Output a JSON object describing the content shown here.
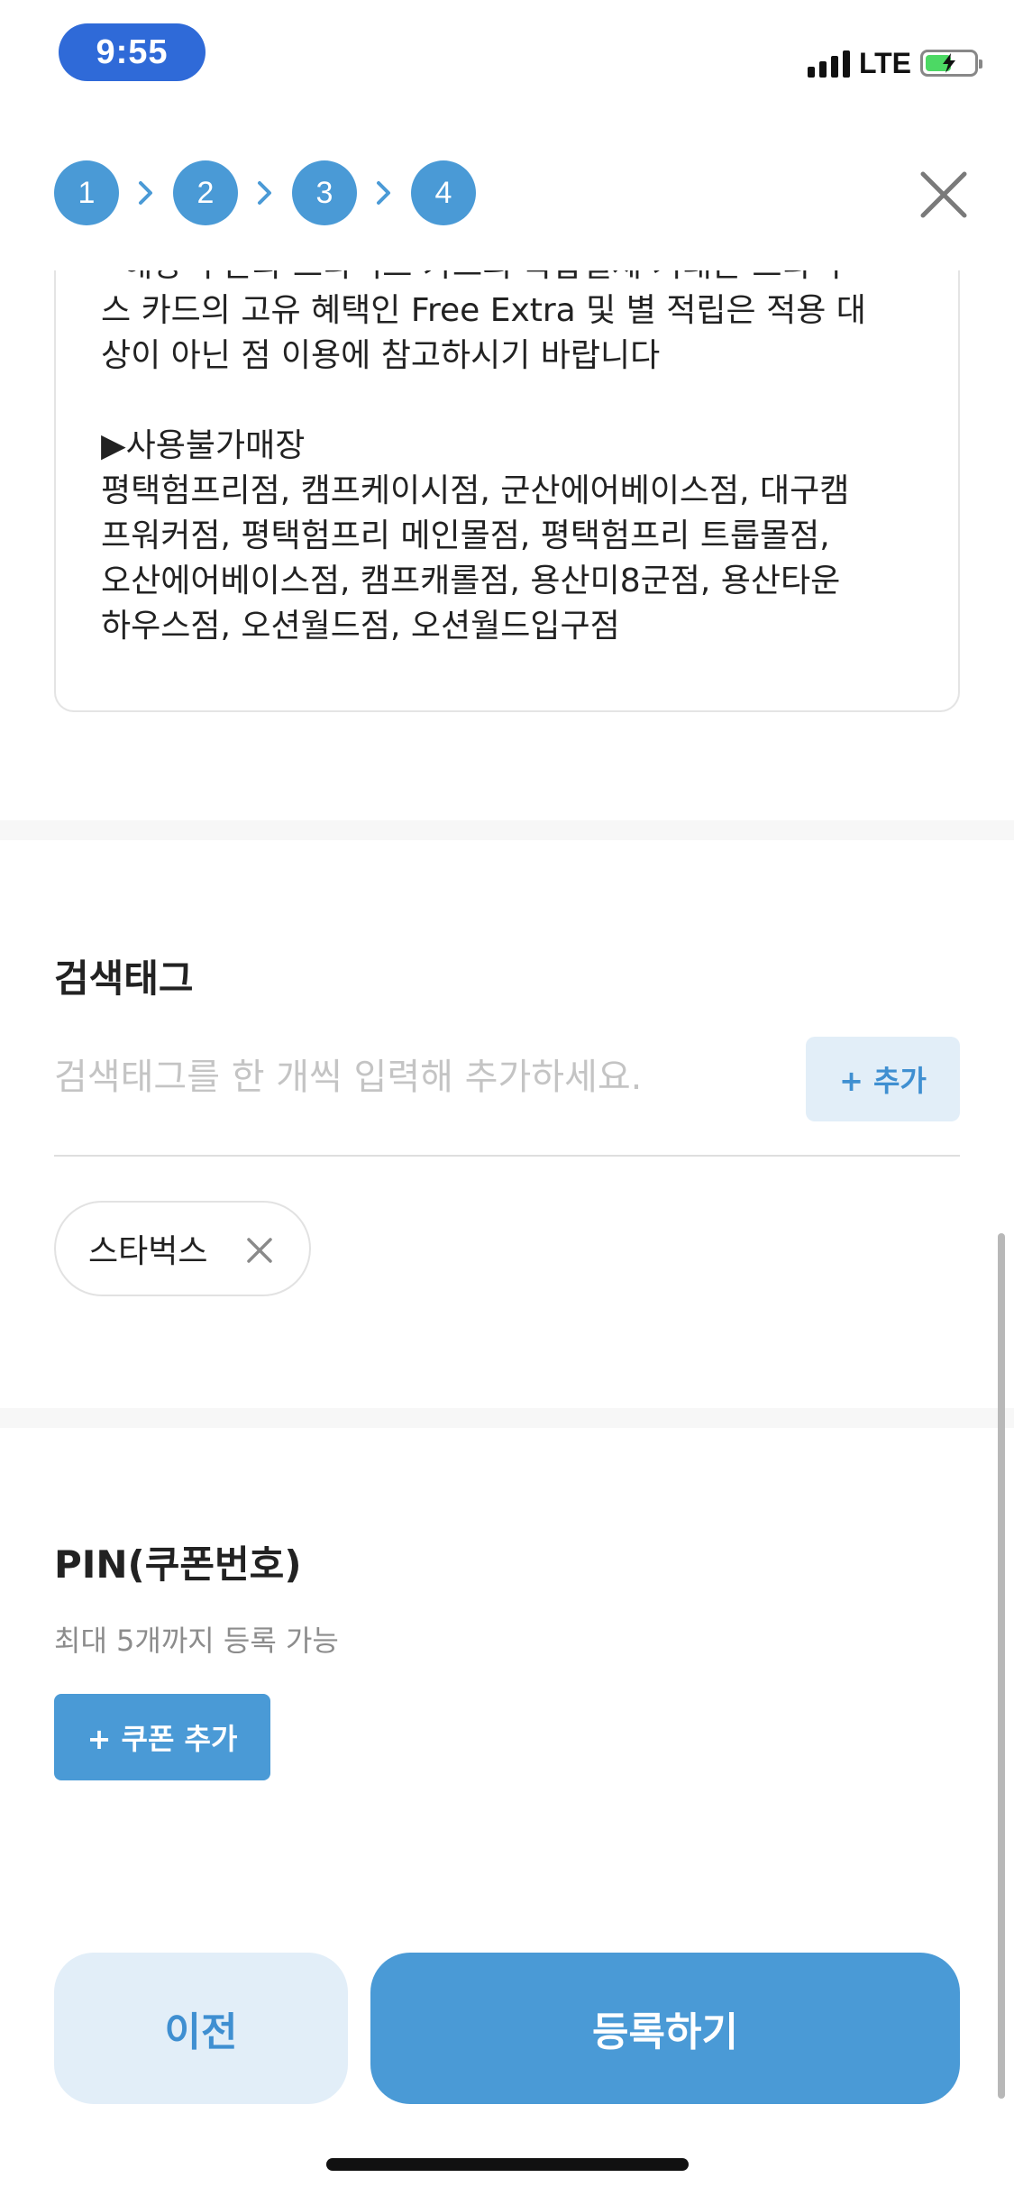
{
  "status_bar": {
    "time": "9:55",
    "network": "LTE"
  },
  "steps": [
    "1",
    "2",
    "3",
    "4"
  ],
  "description": {
    "cut_line": "- 해당 쿠폰과 스타벅스 카드의 복합결제 거래는 스타벅",
    "lines": [
      "스 카드의 고유 혜택인 Free Extra 및 별 적립은 적용 대",
      "상이 아닌 점 이용에 참고하시기 바랍니다"
    ],
    "restricted_heading": "▶사용불가매장",
    "restricted_lines": [
      "평택험프리점, 캠프케이시점, 군산에어베이스점, 대구캠",
      "프워커점, 평택험프리 메인몰점, 평택험프리 트룹몰점,",
      "오산에어베이스점, 캠프캐롤점, 용산미8군점, 용산타운",
      "하우스점, 오션월드점, 오션월드입구점"
    ]
  },
  "search_tag": {
    "title": "검색태그",
    "placeholder": "검색태그를 한 개씩 입력해 추가하세요.",
    "add_label": "+ 추가",
    "tags": [
      "스타벅스"
    ]
  },
  "pin": {
    "title": "PIN(쿠폰번호)",
    "description": "최대 5개까지 등록 가능",
    "add_coupon_label": "+ 쿠폰 추가"
  },
  "footer": {
    "prev_label": "이전",
    "submit_label": "등록하기"
  },
  "colors": {
    "accent": "#4a9ad6",
    "accent_light": "#e2eef8",
    "time_pill": "#2f6ad8"
  }
}
